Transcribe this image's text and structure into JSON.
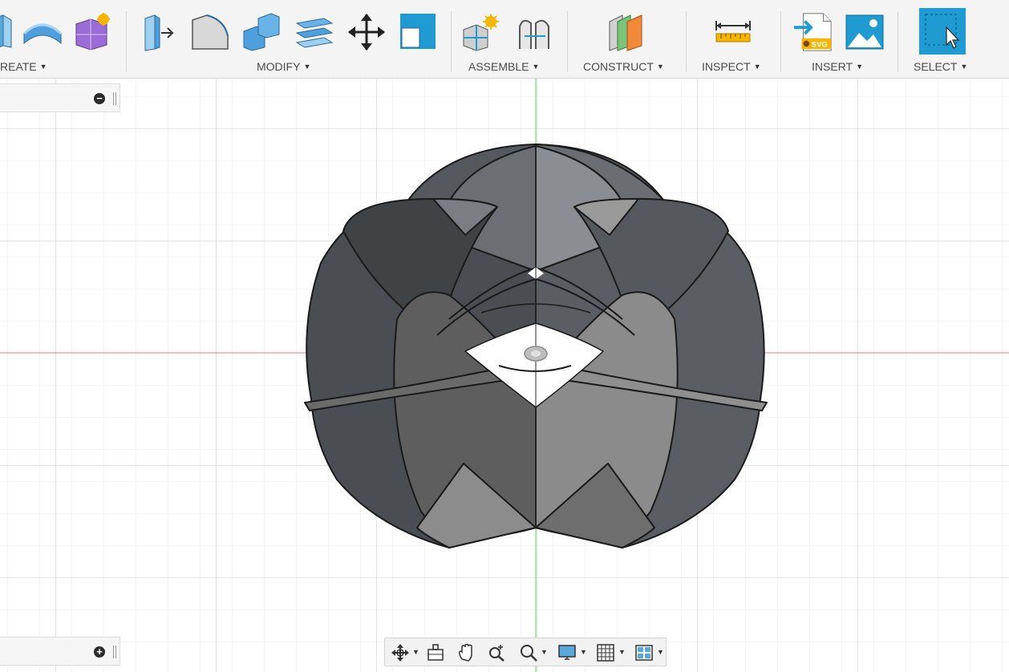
{
  "toolbar": {
    "groups": [
      {
        "label": "REATE",
        "caret": "▼"
      },
      {
        "label": "MODIFY",
        "caret": "▼"
      },
      {
        "label": "ASSEMBLE",
        "caret": "▼"
      },
      {
        "label": "CONSTRUCT",
        "caret": "▼"
      },
      {
        "label": "INSPECT",
        "caret": "▼"
      },
      {
        "label": "INSERT",
        "caret": "▼"
      },
      {
        "label": "SELECT",
        "caret": "▼"
      }
    ],
    "insert_svg_badge": "SVG",
    "icons": [
      "extrude-icon",
      "sweep-icon",
      "create-form-icon",
      "press-pull-icon",
      "fillet-icon",
      "combine-icon",
      "offset-face-icon",
      "move-icon",
      "scale-icon",
      "new-component-icon",
      "joint-icon",
      "construct-plane-icon",
      "measure-icon",
      "insert-svg-icon",
      "insert-image-icon",
      "select-icon"
    ]
  },
  "panels": {
    "top_button": "−",
    "bottom_button": "+"
  },
  "navbar": {
    "icons": [
      "orbit-icon",
      "look-at-icon",
      "pan-icon",
      "zoom-icon",
      "zoom-window-icon",
      "display-settings-icon",
      "grid-settings-icon",
      "viewports-icon"
    ],
    "caret": "▼"
  },
  "colors": {
    "accent": "#1f9bd1",
    "x_axis": "#e87878",
    "y_axis": "#62d062",
    "grid_minor": "#ececec",
    "grid_major": "#c8c8c8",
    "model_dark": "#4a4e52",
    "model_light": "#8c8c8c"
  }
}
